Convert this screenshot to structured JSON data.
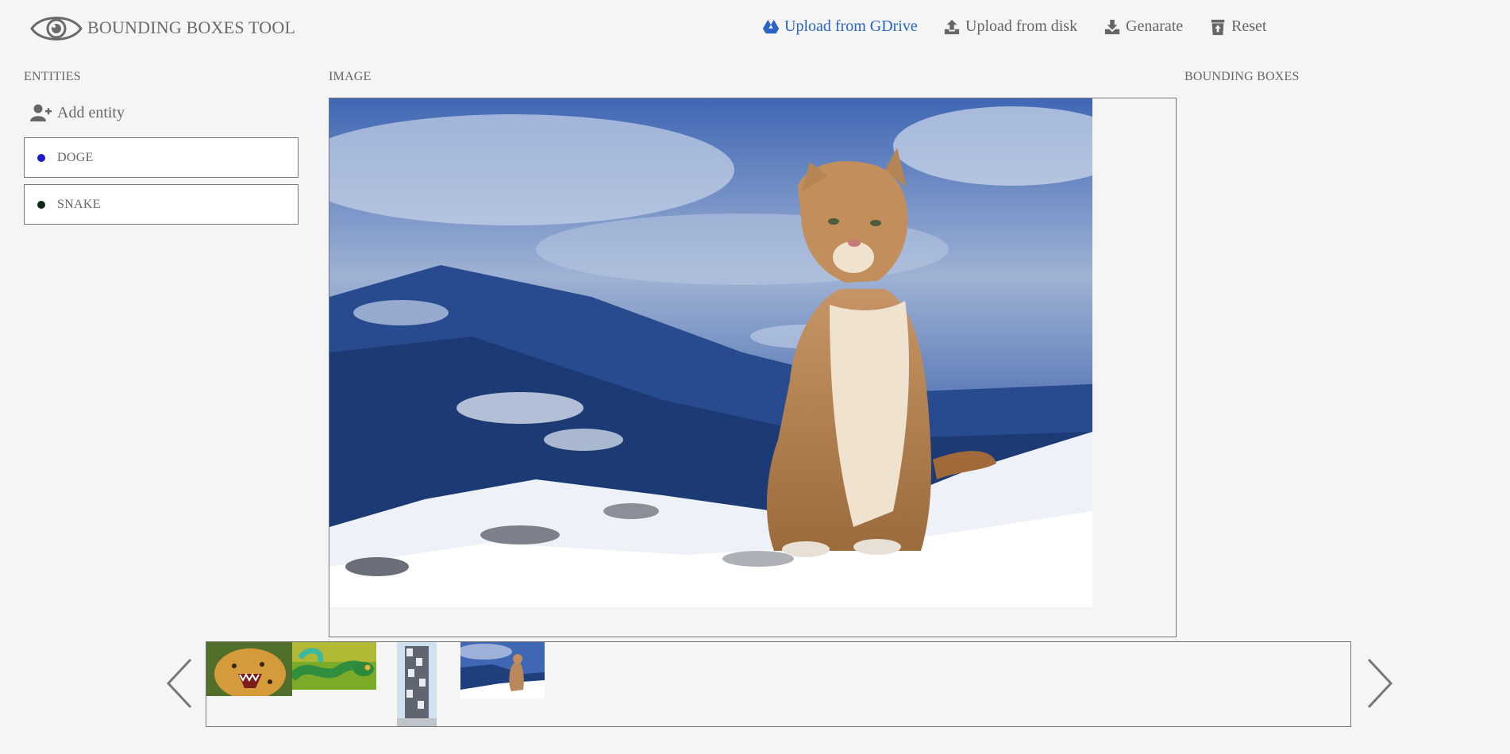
{
  "app": {
    "title": "BOUNDING BOXES TOOL",
    "logo_icon": "eye-icon"
  },
  "toolbar": {
    "gdrive_label": "Upload from GDrive",
    "disk_label": "Upload from disk",
    "generate_label": "Genarate",
    "reset_label": "Reset",
    "gdrive_color": "#2a64c5"
  },
  "sections": {
    "entities": "ENTITIES",
    "image": "IMAGE",
    "boxes": "BOUNDING BOXES"
  },
  "entities": {
    "add_label": "Add entity",
    "items": [
      {
        "name": "DOGE",
        "color": "#1c1cc8"
      },
      {
        "name": "SNAKE",
        "color": "#0f2a12"
      }
    ]
  },
  "main_image": {
    "subject": "cougar sitting on snowy mountain slope"
  },
  "carousel": {
    "thumbnails": [
      {
        "subject": "snarling leopard"
      },
      {
        "subject": "green snake"
      },
      {
        "subject": "tall building"
      },
      {
        "subject": "cougar in snow",
        "selected": true
      }
    ]
  }
}
